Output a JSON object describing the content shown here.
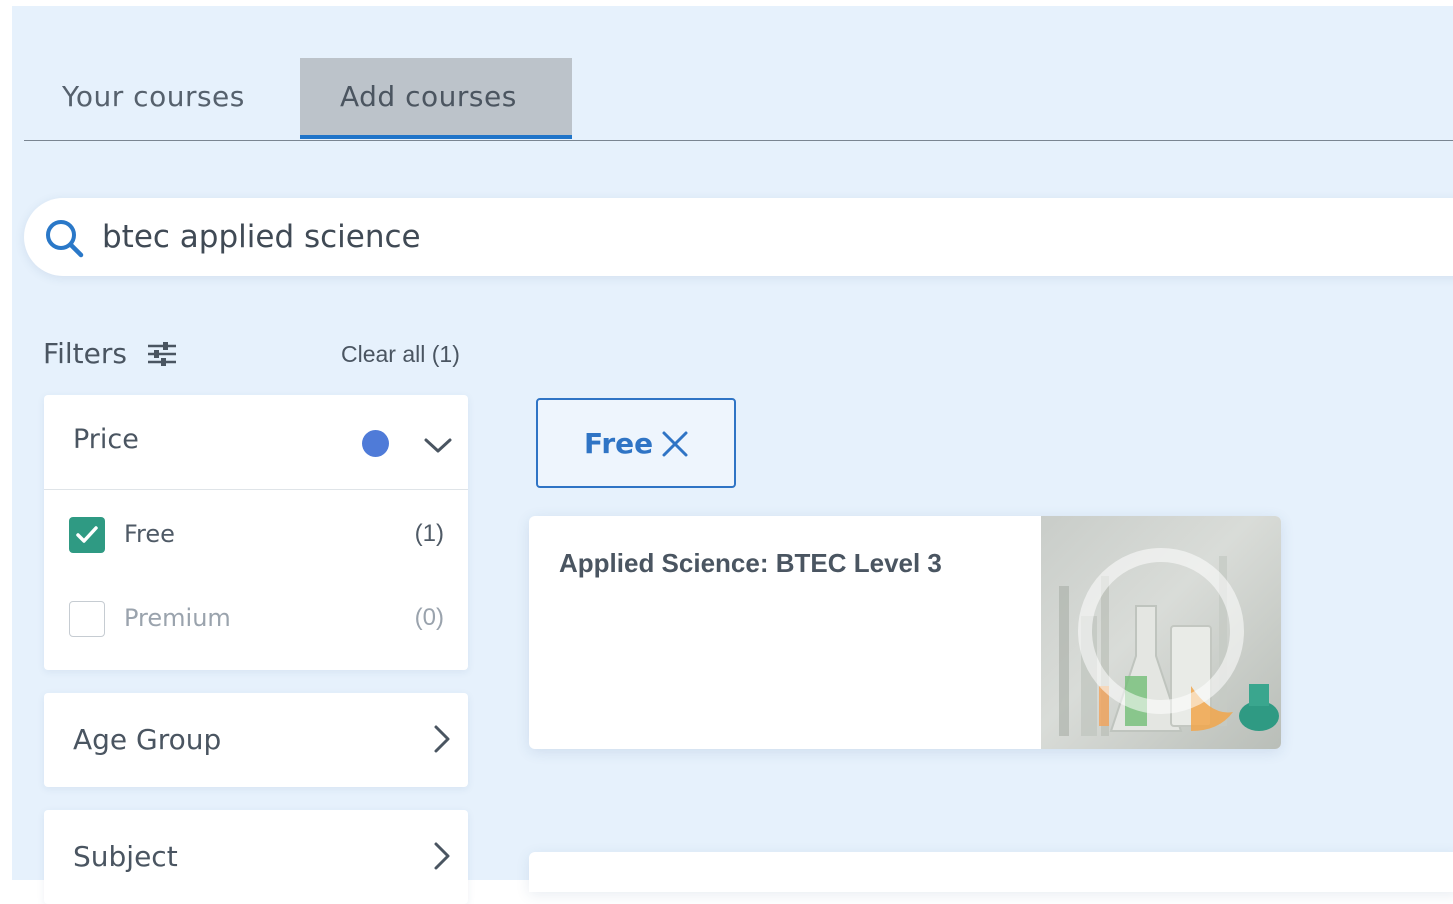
{
  "tabs": [
    {
      "label": "Your courses",
      "active": false
    },
    {
      "label": "Add courses",
      "active": true
    }
  ],
  "search": {
    "value": "btec applied science",
    "icon": "search-icon"
  },
  "filters": {
    "title": "Filters",
    "icon": "sliders-icon",
    "clear_all_label": "Clear all (1)",
    "groups": [
      {
        "title": "Price",
        "expanded": true,
        "active": true,
        "options": [
          {
            "label": "Free",
            "count": "(1)",
            "checked": true
          },
          {
            "label": "Premium",
            "count": "(0)",
            "checked": false
          }
        ]
      },
      {
        "title": "Age Group",
        "expanded": false
      },
      {
        "title": "Subject",
        "expanded": false
      }
    ]
  },
  "active_filters": [
    {
      "label": "Free",
      "icon": "close-icon"
    }
  ],
  "results": [
    {
      "title": "Applied Science: BTEC Level 3",
      "thumbnail": "lab-glassware-image"
    }
  ],
  "colors": {
    "page_background": "#e6f1fc",
    "accent_blue": "#2f74c5",
    "active_dot": "#4f7bd8",
    "checkbox_checked": "#2f9a83",
    "active_tab_bg": "#bcc3ca"
  }
}
